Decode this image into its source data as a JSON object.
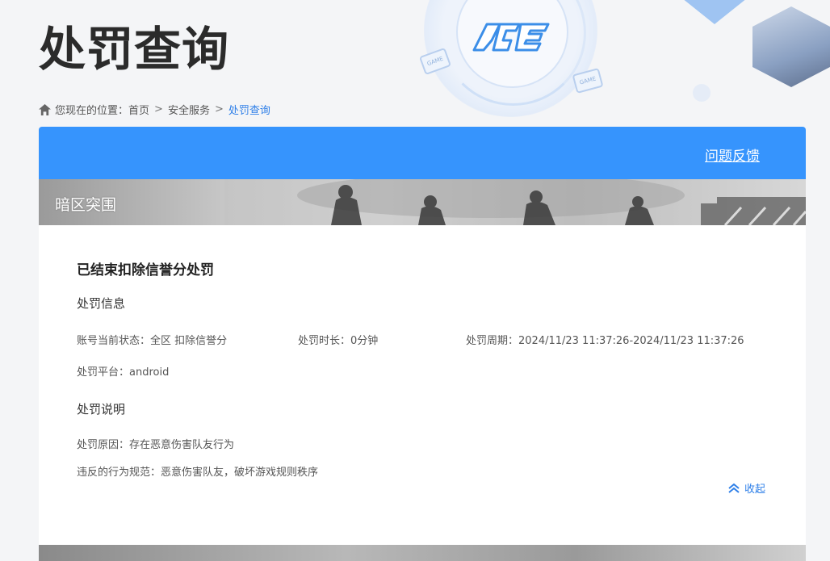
{
  "header": {
    "title": "处罚查询",
    "logo_text": "ACE",
    "game_tag_text": "GAME"
  },
  "breadcrumb": {
    "prefix": "您现在的位置：",
    "items": [
      "首页",
      "安全服务",
      "处罚查询"
    ],
    "separator": ">"
  },
  "toolbar": {
    "feedback_label": "问题反馈"
  },
  "game": {
    "name": "暗区突围"
  },
  "penalty": {
    "title": "已结束扣除信誉分处罚",
    "info_heading": "处罚信息",
    "account_status": "账号当前状态：全区 扣除信誉分",
    "duration": "处罚时长：0分钟",
    "period": "处罚周期：2024/11/23 11:37:26-2024/11/23 11:37:26",
    "platform": "处罚平台：android",
    "desc_heading": "处罚说明",
    "reason": "处罚原因：存在恶意伤害队友行为",
    "violation": "违反的行为规范：恶意伤害队友，破坏游戏规则秩序",
    "collapse_label": "收起"
  },
  "colors": {
    "accent": "#3694fd",
    "link": "#2e7fe8"
  }
}
